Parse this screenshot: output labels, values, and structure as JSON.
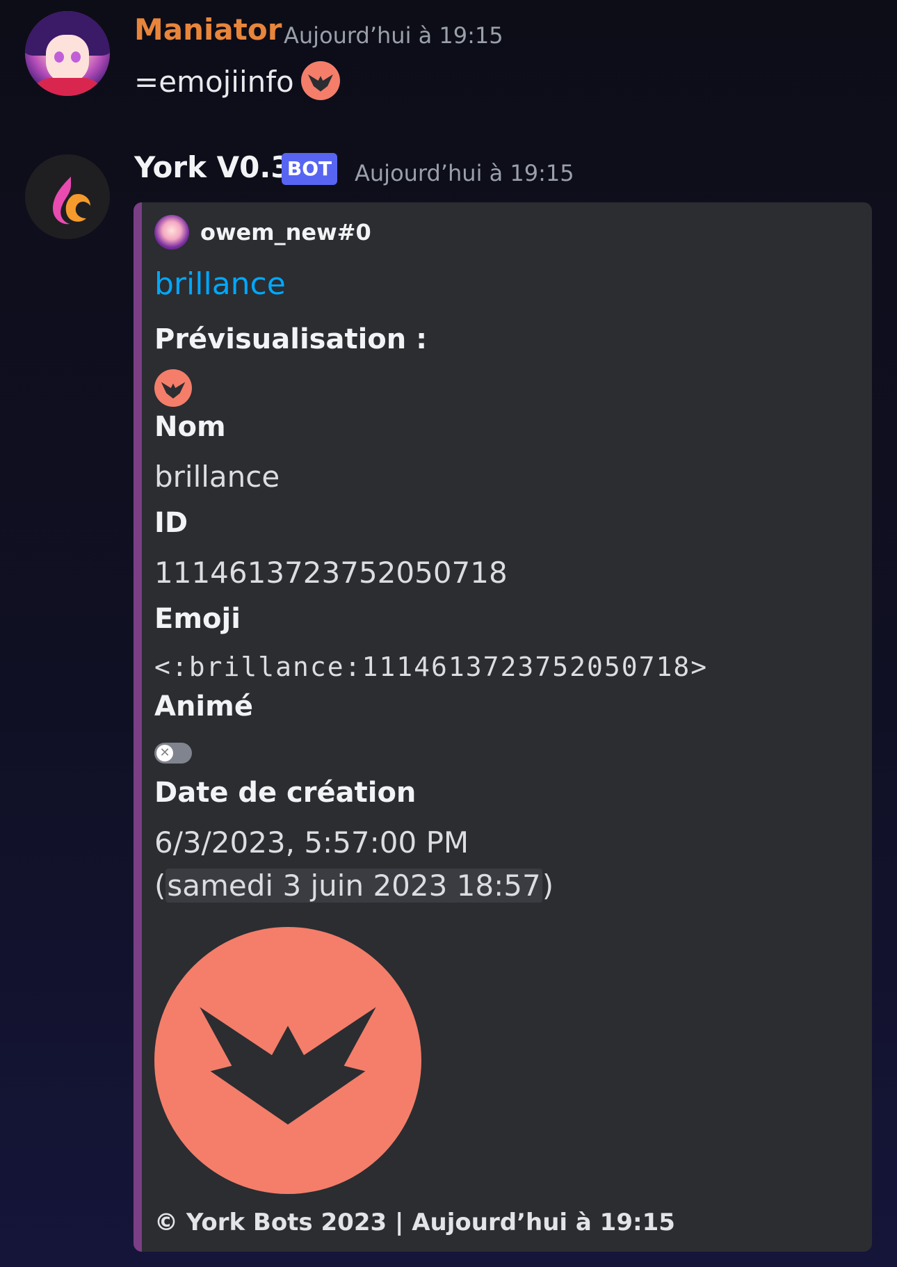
{
  "messages": [
    {
      "username": "Maniator",
      "username_color": "#e8853b",
      "timestamp": "Aujourd’hui à 19:15",
      "content": "=emojiinfo",
      "emoji": "brillance-emoji"
    },
    {
      "username": "York V0.3",
      "badge": "BOT",
      "timestamp": "Aujourd’hui à 19:15",
      "embed": {
        "accent_color": "#7b3f86",
        "author": "owem_new#0",
        "title": "brillance",
        "fields": {
          "preview_label": "Prévisualisation :",
          "name_label": "Nom",
          "name_value": "brillance",
          "id_label": "ID",
          "id_value": "1114613723752050718",
          "emoji_label": "Emoji",
          "emoji_value": "<:brillance:1114613723752050718>",
          "animated_label": "Animé",
          "animated_value": false,
          "date_label": "Date de création",
          "date_value_line1": "6/3/2023, 5:57:00 PM",
          "date_paren_open": "(",
          "date_value_line2": "samedi 3 juin 2023 18:57",
          "date_paren_close": ")"
        },
        "footer": "© York Bots 2023 | Aujourd’hui à 19:15"
      }
    }
  ],
  "colors": {
    "link": "#00a8fc",
    "emoji_fill": "#f47e6a",
    "emoji_glyph": "#2b2d31",
    "bot_badge": "#5865f2"
  }
}
